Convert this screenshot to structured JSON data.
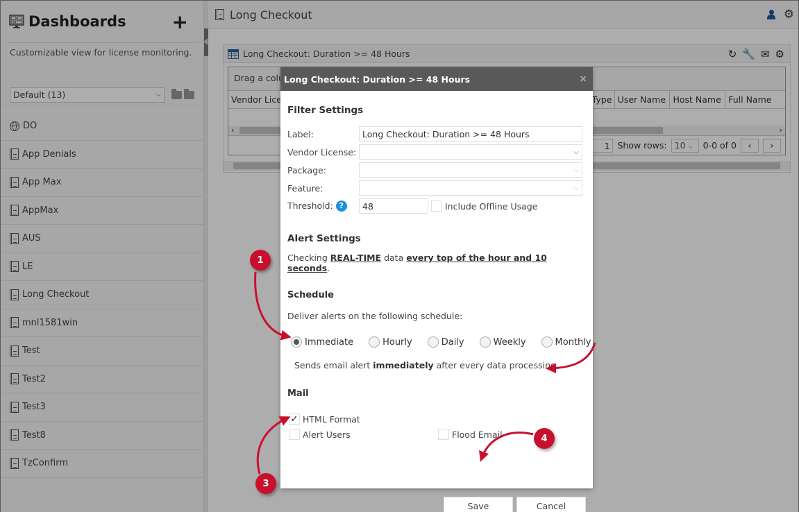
{
  "sidebar": {
    "title": "Dashboards",
    "add_label": "+",
    "description": "Customizable view for license monitoring.",
    "dashboard_select": "Default (13)",
    "items": [
      {
        "label": "DO",
        "icon": "globe-icon"
      },
      {
        "label": "App Denials",
        "icon": "dashboard-doc-icon"
      },
      {
        "label": "App Max",
        "icon": "dashboard-doc-icon"
      },
      {
        "label": "AppMax",
        "icon": "dashboard-doc-icon"
      },
      {
        "label": "AUS",
        "icon": "dashboard-doc-icon"
      },
      {
        "label": "LE",
        "icon": "dashboard-doc-icon"
      },
      {
        "label": "Long Checkout",
        "icon": "dashboard-doc-icon"
      },
      {
        "label": "mnl1581win",
        "icon": "dashboard-doc-icon"
      },
      {
        "label": "Test",
        "icon": "dashboard-doc-icon"
      },
      {
        "label": "Test2",
        "icon": "dashboard-doc-icon"
      },
      {
        "label": "Test3",
        "icon": "dashboard-doc-icon"
      },
      {
        "label": "Test8",
        "icon": "dashboard-doc-icon"
      },
      {
        "label": "TzConfirm",
        "icon": "dashboard-doc-icon"
      }
    ]
  },
  "header": {
    "title": "Long Checkout",
    "user_icon": "user-icon",
    "settings_icon": "gear-icon"
  },
  "widget": {
    "title": "Long Checkout: Duration >= 48 Hours",
    "tools": [
      "refresh-icon",
      "wrench-icon",
      "mail-alert-icon",
      "gear-icon"
    ],
    "drag_hint": "Drag a colur",
    "columns_left": [
      "Vendor Lice"
    ],
    "columns_right": [
      "Type",
      "User Name",
      "Host Name",
      "Full Name"
    ],
    "pager": {
      "page": "1",
      "show_rows_label": "Show rows:",
      "rows": "10",
      "range": "0-0 of 0",
      "prev": "‹",
      "next": "›"
    }
  },
  "dialog": {
    "title": "Long Checkout: Duration >= 48 Hours",
    "close": "×",
    "filter_settings": {
      "heading": "Filter Settings",
      "label_label": "Label:",
      "label_value": "Long Checkout: Duration >= 48 Hours",
      "vendor_license_label": "Vendor License:",
      "vendor_license_value": "",
      "package_label": "Package:",
      "package_value": "",
      "feature_label": "Feature:",
      "feature_value": "",
      "threshold_label": "Threshold:",
      "threshold_value": "48",
      "include_offline_label": "Include Offline Usage",
      "include_offline_checked": false
    },
    "alert_settings": {
      "heading": "Alert Settings",
      "checking_prefix": "Checking",
      "checking_mode": "REAL-TIME",
      "checking_mid": "data",
      "checking_interval": "every top of the hour and 10 seconds",
      "checking_suffix": "."
    },
    "schedule": {
      "heading": "Schedule",
      "intro": "Deliver alerts on the following schedule:",
      "options": [
        "Immediate",
        "Hourly",
        "Daily",
        "Weekly",
        "Monthly"
      ],
      "selected": "Immediate",
      "desc_prefix": "Sends email alert",
      "desc_bold": "immediately",
      "desc_suffix": "after every data processing."
    },
    "mail": {
      "heading": "Mail",
      "html_format_label": "HTML Format",
      "html_format_checked": true,
      "alert_users_label": "Alert Users",
      "alert_users_checked": false,
      "flood_email_label": "Flood Email",
      "flood_email_checked": false
    },
    "save_label": "Save",
    "cancel_label": "Cancel"
  },
  "annotations": {
    "badges": [
      "1",
      "3",
      "4"
    ],
    "color": "#c8102e"
  }
}
